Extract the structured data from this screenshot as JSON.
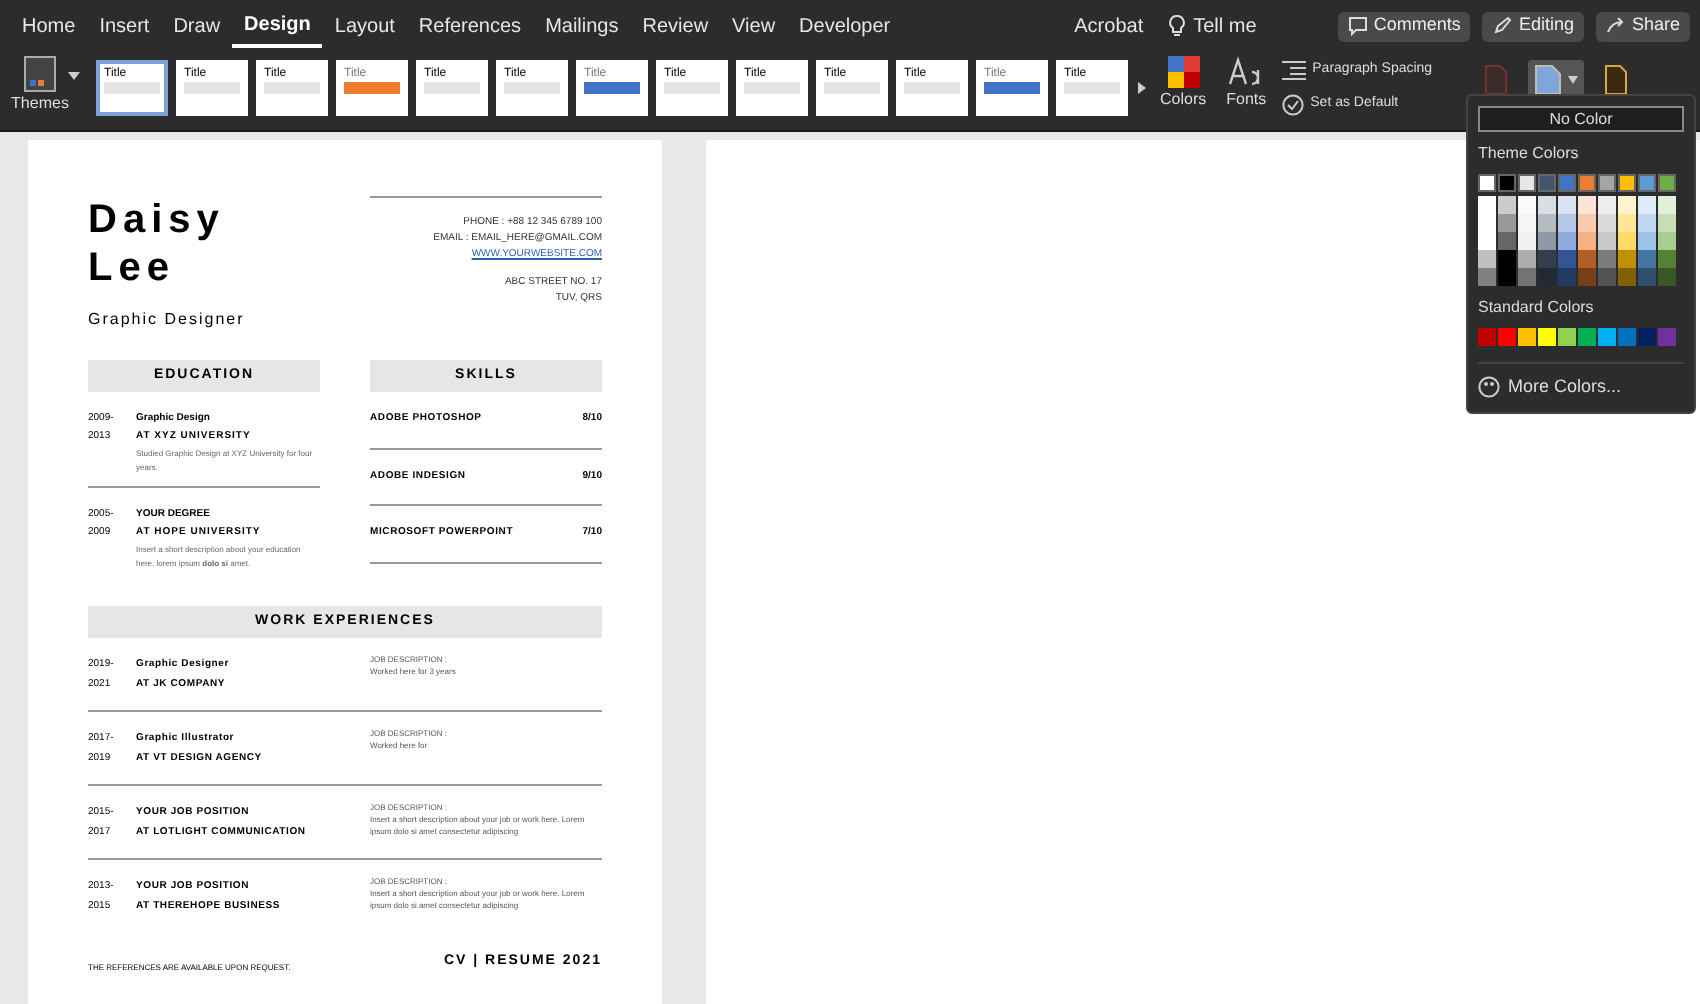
{
  "menu_tabs": [
    {
      "label": "Home",
      "selected": false
    },
    {
      "label": "Insert",
      "selected": false
    },
    {
      "label": "Draw",
      "selected": false
    },
    {
      "label": "Design",
      "selected": true
    },
    {
      "label": "Layout",
      "selected": false
    },
    {
      "label": "References",
      "selected": false
    },
    {
      "label": "Mailings",
      "selected": false
    },
    {
      "label": "Review",
      "selected": false
    },
    {
      "label": "View",
      "selected": false
    },
    {
      "label": "Developer",
      "selected": false
    }
  ],
  "acrobat": "Acrobat",
  "tell_me": "Tell me",
  "top_buttons": [
    {
      "label": "Comments",
      "kind": "comments"
    },
    {
      "label": "Editing",
      "kind": "editing"
    },
    {
      "label": "Share",
      "kind": "share"
    }
  ],
  "ribbon": {
    "themes": "Themes",
    "styles": [
      {
        "title": "Title",
        "selected": true
      },
      {
        "title": "Title",
        "selected": false
      },
      {
        "title": "Title",
        "selected": false
      },
      {
        "title": "Title",
        "selected": false
      },
      {
        "title": "Title",
        "selected": false
      },
      {
        "title": "Title",
        "selected": false
      },
      {
        "title": "Title",
        "selected": false
      },
      {
        "title": "Title",
        "selected": false
      },
      {
        "title": "Title",
        "selected": false
      },
      {
        "title": "Title",
        "selected": false
      },
      {
        "title": "Title",
        "selected": false
      },
      {
        "title": "Title",
        "selected": false
      },
      {
        "title": "Title",
        "selected": false
      }
    ],
    "colors": "Colors",
    "fonts": "Fonts",
    "paragraph_spacing": "Paragraph Spacing",
    "set_as_default": "Set as Default"
  },
  "color_menu": {
    "no_color": "No Color",
    "theme_heading": "Theme Colors",
    "theme_colors": [
      {
        "color": "#ffffff"
      },
      {
        "color": "#000000"
      },
      {
        "color": "#e7e6e6"
      },
      {
        "color": "#44546a"
      },
      {
        "color": "#4472c4"
      },
      {
        "color": "#ed7d31"
      },
      {
        "color": "#a5a5a5"
      },
      {
        "color": "#ffc000"
      },
      {
        "color": "#5b9bd5"
      },
      {
        "color": "#70ad47"
      }
    ],
    "standard_heading": "Standard Colors",
    "standard_colors": [
      {
        "color": "#c00000"
      },
      {
        "color": "#ff0000"
      },
      {
        "color": "#ffc000"
      },
      {
        "color": "#ffff00"
      },
      {
        "color": "#92d050"
      },
      {
        "color": "#00b050"
      },
      {
        "color": "#00b0f0"
      },
      {
        "color": "#0070c0"
      },
      {
        "color": "#002060"
      },
      {
        "color": "#7030a0"
      }
    ],
    "more": "More Colors..."
  },
  "resume": {
    "first_name": "Daisy",
    "last_name": "Lee",
    "role": "Graphic Designer",
    "contact": [
      "PHONE : +88 12 345 6789 100",
      "EMAIL : EMAIL_HERE@GMAIL.COM"
    ],
    "website": "WWW.YOURWEBSITE.COM",
    "address": [
      "ABC STREET NO. 17",
      "TUV, QRS"
    ],
    "education_heading": "EDUCATION",
    "skills_heading": "SKILLS",
    "education": [
      {
        "years": [
          "2009-",
          "2013"
        ],
        "title": "Graphic Design",
        "place": "AT XYZ UNIVERSITY",
        "description": "Studied Graphic Design at XYZ University for four years."
      },
      {
        "years": [
          "2005-",
          "2009"
        ],
        "title": "YOUR DEGREE",
        "place": "AT HOPE UNIVERSITY",
        "description": "Insert a short description about your education here. lorem ipsum **dolo si** amet."
      }
    ],
    "skills": [
      {
        "name": "ADOBE PHOTOSHOP",
        "score": "8/10"
      },
      {
        "name": "ADOBE INDESIGN",
        "score": "9/10"
      },
      {
        "name": "MICROSOFT POWERPOINT",
        "score": "7/10"
      }
    ],
    "work_heading": "WORK EXPERIENCES",
    "work": [
      {
        "years": [
          "2019-",
          "2021"
        ],
        "title": "Graphic Designer",
        "place": "AT JK COMPANY",
        "label": "JOB DESCRIPTION :",
        "description": "Worked here for 3 years"
      },
      {
        "years": [
          "2017-",
          "2019"
        ],
        "title": "Graphic Illustrator",
        "place": "AT VT DESIGN AGENCY",
        "label": "JOB DESCRIPTION :",
        "description": "Worked here for"
      },
      {
        "years": [
          "2015-",
          "2017"
        ],
        "title": "YOUR JOB POSITION",
        "place": "AT LOTLIGHT COMMUNICATION",
        "label": "JOB DESCRIPTION :",
        "description": "Insert a short description about your job or work here. Lorem ipsum dolo si amet consectetur adipiscing"
      },
      {
        "years": [
          "2013-",
          "2015"
        ],
        "title": "YOUR JOB POSITION",
        "place": "AT THEREHOPE BUSINESS",
        "label": "JOB DESCRIPTION :",
        "description": "Insert a short description about your job or work here. Lorem ipsum dolo si amet consectetur adipiscing"
      }
    ],
    "references": "THE REFERENCES ARE AVAILABLE UPON REQUEST.",
    "footer": "CV | RESUME 2021"
  }
}
